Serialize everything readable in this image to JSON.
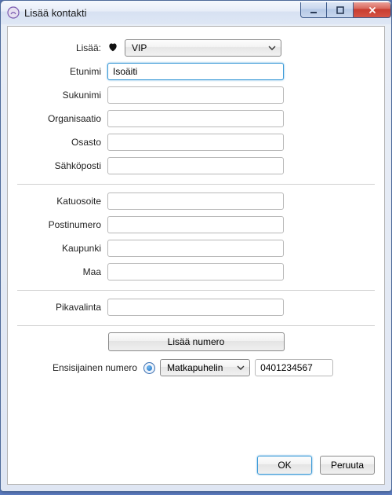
{
  "window": {
    "title": "Lisää kontakti"
  },
  "form": {
    "add_label": "Lisää:",
    "vip_selected": "VIP",
    "fields": {
      "firstname": {
        "label": "Etunimi",
        "value": "Isoäiti"
      },
      "lastname": {
        "label": "Sukunimi",
        "value": ""
      },
      "org": {
        "label": "Organisaatio",
        "value": ""
      },
      "dept": {
        "label": "Osasto",
        "value": ""
      },
      "email": {
        "label": "Sähköposti",
        "value": ""
      },
      "street": {
        "label": "Katuosoite",
        "value": ""
      },
      "zip": {
        "label": "Postinumero",
        "value": ""
      },
      "city": {
        "label": "Kaupunki",
        "value": ""
      },
      "country": {
        "label": "Maa",
        "value": ""
      },
      "speeddial": {
        "label": "Pikavalinta",
        "value": ""
      }
    },
    "add_number_label": "Lisää numero",
    "primary_number_label": "Ensisijainen numero",
    "phone_type_selected": "Matkapuhelin",
    "phone_value": "0401234567"
  },
  "buttons": {
    "ok": "OK",
    "cancel": "Peruuta"
  }
}
